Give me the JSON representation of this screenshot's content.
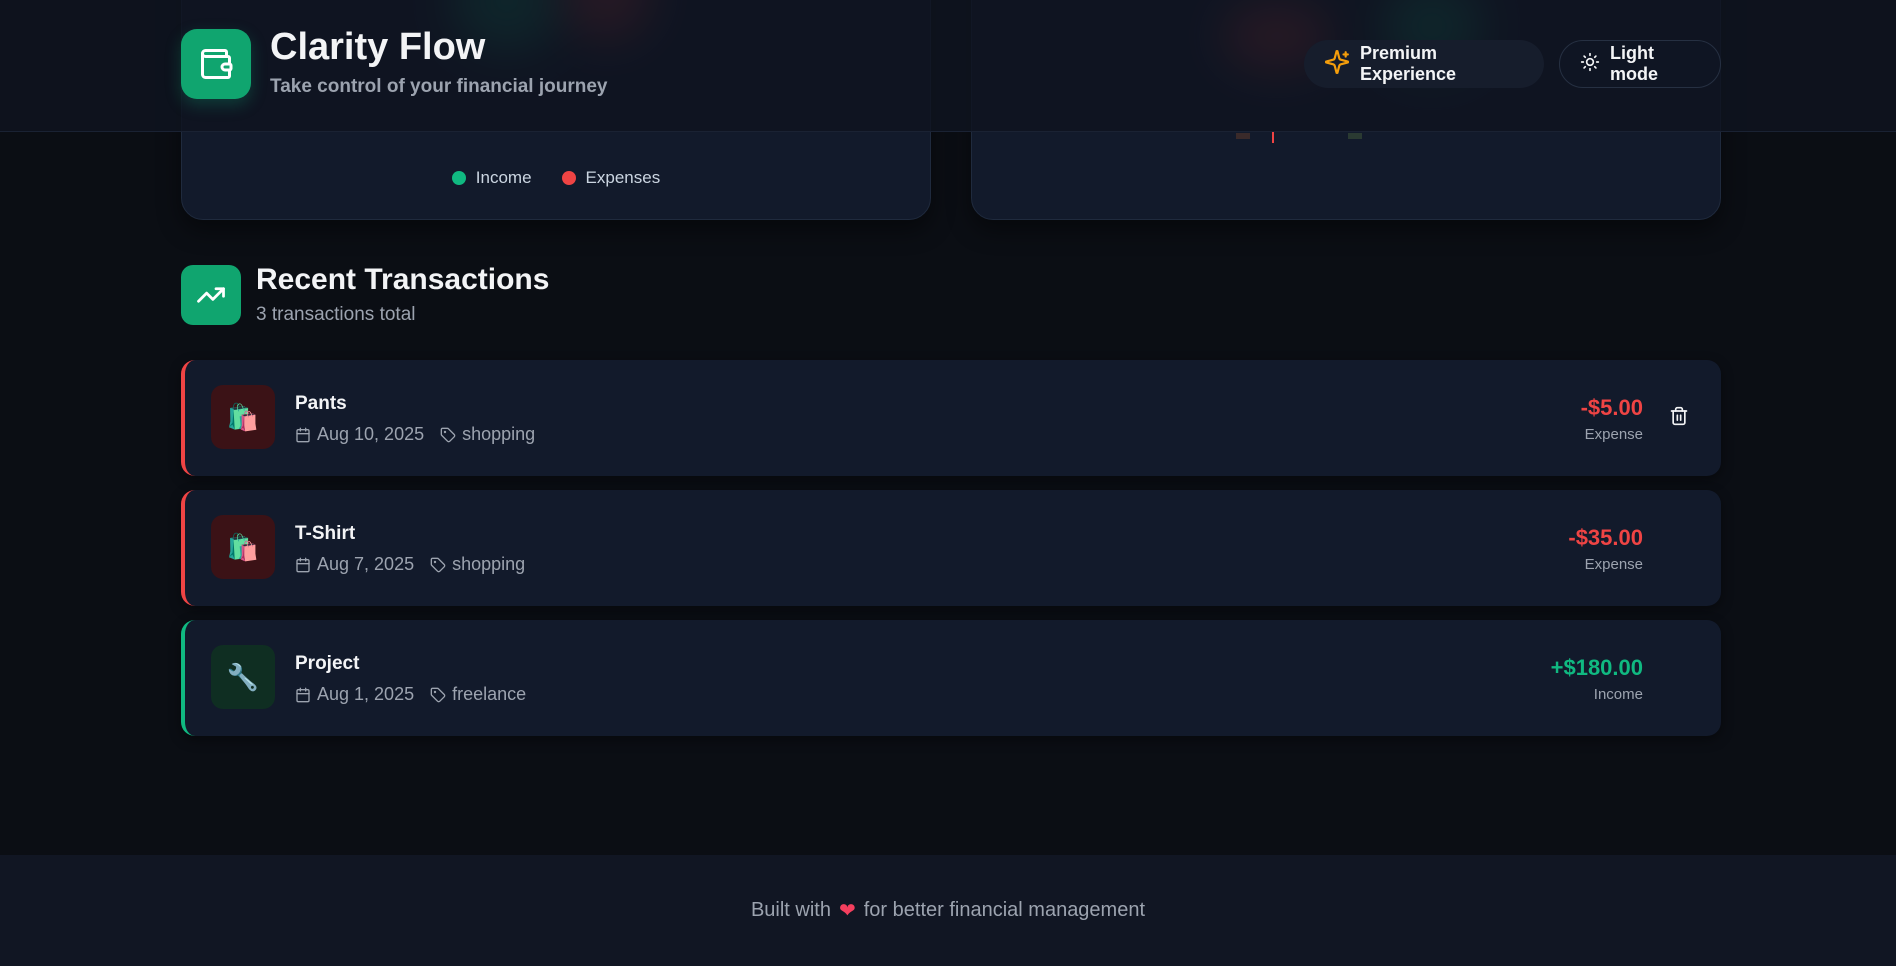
{
  "app": {
    "title": "Clarity Flow",
    "subtitle": "Take control of your financial journey",
    "logo_icon": "wallet-icon"
  },
  "header_actions": {
    "premium_label": "Premium Experience",
    "premium_icon": "sparkles-icon",
    "theme_label": "Light mode",
    "theme_icon": "sun-icon"
  },
  "chart_legend": {
    "income_label": "Income",
    "expenses_label": "Expenses",
    "income_color": "#10b981",
    "expenses_color": "#ef4444"
  },
  "transactions_section": {
    "title": "Recent Transactions",
    "subtitle": "3 transactions total",
    "icon": "trending-up-icon"
  },
  "transactions": [
    {
      "name": "Pants",
      "date": "Aug 10, 2025",
      "category": "shopping",
      "amount": "-$5.00",
      "type": "Expense",
      "icon": "shopping-bags-icon",
      "glyph": "🛍️",
      "show_delete": true
    },
    {
      "name": "T-Shirt",
      "date": "Aug 7, 2025",
      "category": "shopping",
      "amount": "-$35.00",
      "type": "Expense",
      "icon": "shopping-bags-icon",
      "glyph": "🛍️",
      "show_delete": false
    },
    {
      "name": "Project",
      "date": "Aug 1, 2025",
      "category": "freelance",
      "amount": "+$180.00",
      "type": "Income",
      "icon": "wrench-icon",
      "glyph": "🔧",
      "show_delete": false
    }
  ],
  "footer": {
    "prefix": "Built with",
    "heart": "❤",
    "suffix": "for better financial management"
  },
  "colors": {
    "accent": "#10a56f",
    "expense": "#ef4444",
    "income": "#10b981",
    "background": "#0b0e14",
    "card": "#121a2b"
  }
}
